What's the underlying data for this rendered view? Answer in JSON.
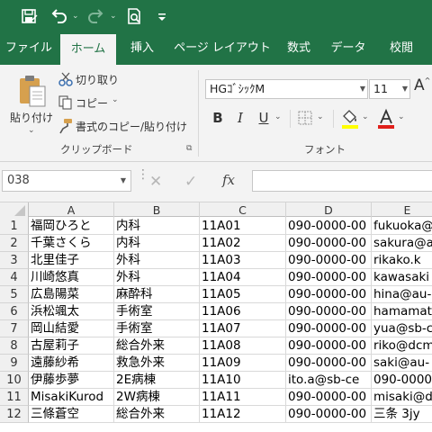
{
  "colors": {
    "brand": "#217346",
    "ribbon": "#f3f3f3",
    "grid_line": "#d9d9d9"
  },
  "quick_access": {
    "icons": [
      "save-icon",
      "undo-icon",
      "redo-icon",
      "print-preview-icon",
      "customize-icon"
    ]
  },
  "tabs": [
    {
      "label": "ファイル",
      "active": false
    },
    {
      "label": "ホーム",
      "active": true
    },
    {
      "label": "挿入",
      "active": false
    },
    {
      "label": "ページ レイアウト",
      "active": false
    },
    {
      "label": "数式",
      "active": false
    },
    {
      "label": "データ",
      "active": false
    },
    {
      "label": "校閲",
      "active": false
    }
  ],
  "clipboard": {
    "paste": "貼り付け",
    "cut": "切り取り",
    "copy": "コピー",
    "format_painter": "書式のコピー/貼り付け",
    "group_label": "クリップボード"
  },
  "font": {
    "name": "HGｺﾞｼｯｸM",
    "size": "11",
    "group_label": "フォント",
    "bold": "B",
    "italic": "I",
    "underline": "U"
  },
  "formula_bar": {
    "name_box": "038",
    "fx": "fx",
    "formula": ""
  },
  "sheet": {
    "columns": [
      "A",
      "B",
      "C",
      "D",
      "E"
    ],
    "rows": [
      {
        "n": "1",
        "cells": [
          "福岡ひろと",
          "内科",
          "11A01",
          "090-0000-00",
          "fukuoka@"
        ]
      },
      {
        "n": "2",
        "cells": [
          "千葉さくら",
          "内科",
          "11A02",
          "090-0000-00",
          "sakura@a"
        ]
      },
      {
        "n": "3",
        "cells": [
          "北里佳子",
          "外科",
          "11A03",
          "090-0000-00",
          "rikako.k"
        ]
      },
      {
        "n": "4",
        "cells": [
          "川崎悠真",
          "外科",
          "11A04",
          "090-0000-00",
          "kawasaki"
        ]
      },
      {
        "n": "5",
        "cells": [
          "広島陽菜",
          "麻酔科",
          "11A05",
          "090-0000-00",
          "hina@au-"
        ]
      },
      {
        "n": "6",
        "cells": [
          "浜松颯太",
          "手術室",
          "11A06",
          "090-0000-00",
          "hamamats"
        ]
      },
      {
        "n": "7",
        "cells": [
          "岡山結愛",
          "手術室",
          "11A07",
          "090-0000-00",
          "yua@sb-c"
        ]
      },
      {
        "n": "8",
        "cells": [
          "古屋莉子",
          "総合外来",
          "11A08",
          "090-0000-00",
          "riko@dcm"
        ]
      },
      {
        "n": "9",
        "cells": [
          "遠藤紗希",
          "救急外来",
          "11A09",
          "090-0000-00",
          "saki@au-"
        ]
      },
      {
        "n": "10",
        "cells": [
          "伊藤歩夢",
          "2E病棟",
          "11A10",
          "ito.a@sb-ce",
          "090-0000"
        ]
      },
      {
        "n": "11",
        "cells": [
          "MisakiKurod",
          "2W病棟",
          "11A11",
          "090-0000-00",
          "misaki@d"
        ]
      },
      {
        "n": "12",
        "cells": [
          "三條蒼空",
          "総合外来",
          "11A12",
          "090-0000-00",
          "三条 3jy"
        ]
      }
    ]
  }
}
